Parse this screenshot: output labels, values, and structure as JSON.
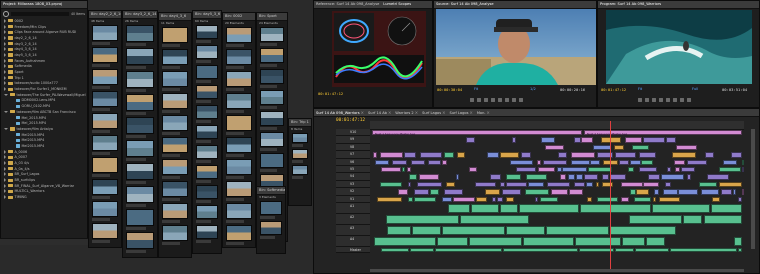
{
  "colors": {
    "bg": "#2a2a2a",
    "panel": "#1e1e1e",
    "playhead": "#e04040",
    "timecode": "#ffcc33",
    "clip_purple": "#8f7ac9",
    "clip_pink": "#d28bd2",
    "clip_green": "#58c08f",
    "clip_blue": "#7a8ed8",
    "clip_orange": "#d9a54a",
    "folder": "#cfa84a"
  },
  "project": {
    "title": "Project: Millaraas 1808_03.prproj",
    "count": "40 Items",
    "items": [
      {
        "label": "0002",
        "type": "folder",
        "open": false
      },
      {
        "label": "Freedom/Mtn Clips",
        "type": "folder",
        "open": false
      },
      {
        "label": "Clips Face around Algarve RUB RUDI",
        "type": "folder",
        "open": false
      },
      {
        "label": "day2_2_6_14",
        "type": "folder",
        "open": false
      },
      {
        "label": "day3_2_6_14",
        "type": "folder",
        "open": false
      },
      {
        "label": "day4_3_6_14",
        "type": "folder",
        "open": false
      },
      {
        "label": "day5_3_6_14",
        "type": "folder",
        "open": false
      },
      {
        "label": "Faces_Aufnahmen",
        "type": "folder",
        "open": false
      },
      {
        "label": "Softmedia",
        "type": "folder",
        "open": false
      },
      {
        "label": "Sport",
        "type": "folder",
        "open": false
      },
      {
        "label": "Trip 1",
        "type": "folder",
        "open": false
      },
      {
        "label": "takeover/sudio 1000a777",
        "type": "folder",
        "open": false
      },
      {
        "label": "takeover/For Surfer1_MONKEM",
        "type": "folder",
        "open": false
      },
      {
        "label": "takeover/The Surfer_PA-Wavewall/Miguel",
        "type": "folder",
        "open": true
      },
      {
        "label": "DDM0002.Lens.MP4",
        "type": "file",
        "open": false
      },
      {
        "label": "GORU_0102.MP4",
        "type": "file",
        "open": false
      },
      {
        "label": "takeover/film ABCTB San Francisco",
        "type": "folder",
        "open": true
      },
      {
        "label": "Mel_2015.MP4",
        "type": "file",
        "open": false
      },
      {
        "label": "Mel_2015.MP4",
        "type": "file",
        "open": false
      },
      {
        "label": "takeover/film Antalya",
        "type": "folder",
        "open": true
      },
      {
        "label": "Mel2015.MP4",
        "type": "file",
        "open": false
      },
      {
        "label": "Mel2015.MP4",
        "type": "file",
        "open": false
      },
      {
        "label": "Mel2015.MP4",
        "type": "file",
        "open": false
      },
      {
        "label": "A_0006",
        "type": "folder",
        "open": false
      },
      {
        "label": "A_0007",
        "type": "folder",
        "open": false
      },
      {
        "label": "A_03 4/s",
        "type": "folder",
        "open": false
      },
      {
        "label": "A_0a_4/s",
        "type": "folder",
        "open": false
      },
      {
        "label": "BR_Surf_Lagos",
        "type": "folder",
        "open": false
      },
      {
        "label": "BR_surfclips",
        "type": "folder",
        "open": false
      },
      {
        "label": "BR_FINAL_Surf_Algarve_V8_Warriar",
        "type": "folder",
        "open": false
      },
      {
        "label": "MULTICL_Warriors",
        "type": "folder",
        "open": false
      },
      {
        "label": "TIMING",
        "type": "folder",
        "open": false
      }
    ]
  },
  "bins": [
    {
      "title": "Bin: day2_2_6_14",
      "count": "48 Items"
    },
    {
      "title": "Bin: day3_2_6_14",
      "count": "26 Items"
    },
    {
      "title": "Bin: day4_3_6",
      "count": "11 Items"
    },
    {
      "title": "Bin: day5_3_6",
      "count": "69 Items"
    },
    {
      "title": "Bin: 0002",
      "count": "20 Elements"
    },
    {
      "title": "Bin: Sport",
      "count": "24 Elements"
    },
    {
      "title": "Bin: Trip 1",
      "count": "8 Items"
    },
    {
      "title": "Bin: Softmedia",
      "count": "3 Elements"
    }
  ],
  "scopes": {
    "tab1": "Reference: Surf 14 Ab 098_Analyse",
    "tab2": "Lumetri Scopes"
  },
  "source_monitor": {
    "title": "Source: Surf 14 Ab 098_Analyse",
    "tc_left": "00:00:30:04",
    "tc_right": "00:00:20:16",
    "fit": "Fit",
    "resolution": "1/2"
  },
  "program_monitor": {
    "title": "Program: Surf 14 Ab 098_Warriors",
    "tc_left": "00:01:47:12",
    "tc_right": "00:03:51:04",
    "fit": "Fit",
    "resolution": "Full"
  },
  "scope_tc": "00:01:47:12",
  "timeline": {
    "tabs": [
      "Surf 14 Ab 098_Warriors",
      "Surf 14 Ab",
      "Warriors 2",
      "Surf Lagos",
      "Surf Lagos",
      "Mon."
    ],
    "timecode": "00:01:47:12",
    "video_tracks": [
      "V10",
      "V9",
      "V8",
      "V7",
      "V6",
      "V5",
      "V4",
      "V3",
      "V2",
      "V1"
    ],
    "audio_tracks": [
      "A1",
      "A2",
      "A3",
      "A4",
      "Master"
    ],
    "seq_label_1": "Nest 1 Sequence Master Seq",
    "seq_label_2": "Nest 2 Sequence Master Seq"
  }
}
